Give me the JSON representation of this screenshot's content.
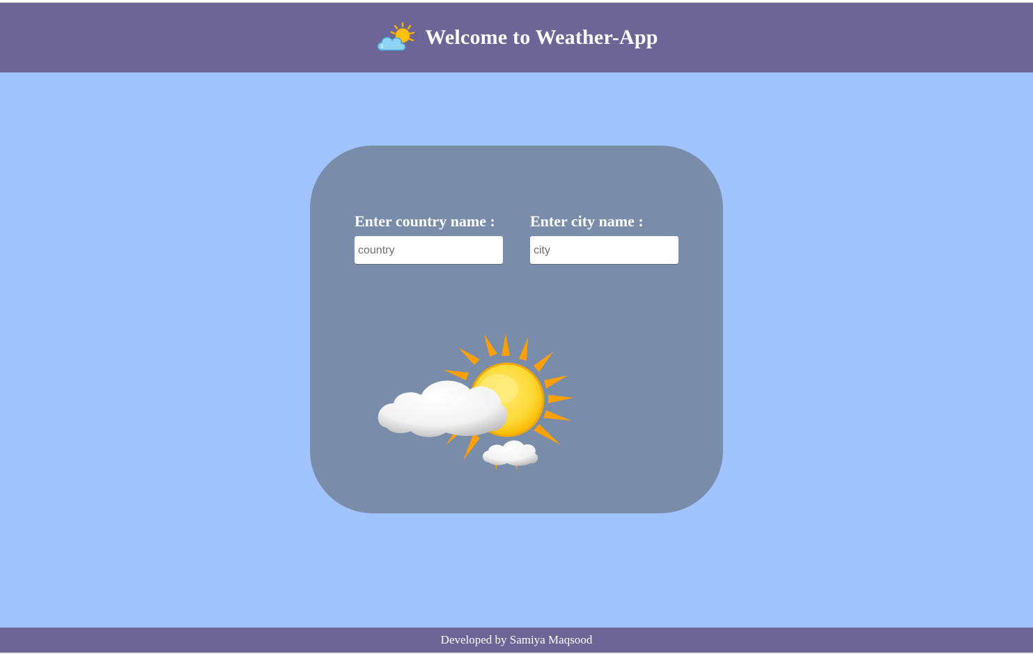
{
  "header": {
    "title": "Welcome to Weather-App",
    "icon": "sun-behind-cloud-icon"
  },
  "form": {
    "country": {
      "label": "Enter country name :",
      "placeholder": "country",
      "value": ""
    },
    "city": {
      "label": "Enter city name :",
      "placeholder": "city",
      "value": ""
    }
  },
  "illustration": {
    "icon": "sun-with-clouds-illustration"
  },
  "footer": {
    "text": "Developed by Samiya Maqsood"
  },
  "colors": {
    "background": "#a0c3fe",
    "header_footer": "#6e6597",
    "card": "#798ca9",
    "sun": "#fdd835",
    "sun_rays": "#ffa000",
    "text": "#ffffff"
  }
}
